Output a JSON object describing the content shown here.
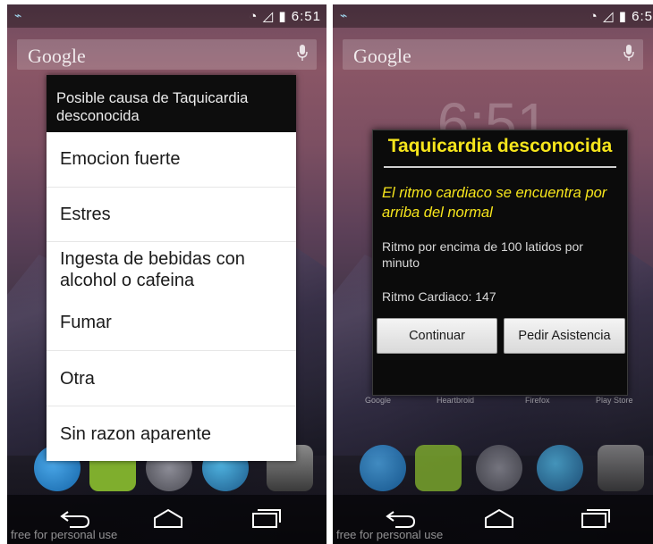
{
  "left_screen": {
    "status_time": "6:51",
    "search_label": "Google",
    "dialog": {
      "title": "Posible causa de Taquicardia desconocida",
      "options": [
        "Emocion fuerte",
        "Estres",
        "Ingesta de bebidas con alcohol o cafeina",
        "Fumar",
        "Otra",
        "Sin razon aparente"
      ]
    },
    "watermark": "free for personal use"
  },
  "right_screen": {
    "status_time": "6:5",
    "search_label": "Google",
    "clock_ghost": "6:51",
    "dialog": {
      "title": "Taquicardia desconocida",
      "subtitle": "El ritmo cardiaco se encuentra por arriba del normal",
      "description": "Ritmo por encima de 100 latidos por minuto",
      "rate": "Ritmo Cardiaco: 147",
      "continue_label": "Continuar",
      "assist_label": "Pedir Asistencia"
    },
    "app_labels": [
      "Google",
      "Heartbroid",
      "Firefox",
      "Play Store"
    ],
    "watermark": "free for personal use"
  },
  "colors": {
    "dialog_title_yellow": "#f6e51c",
    "dialog_bg_dark": "#0b0b0b",
    "status_icon_blue": "#9fd6ee"
  },
  "icons": [
    "pulse-icon",
    "wifi-icon",
    "signal-icon",
    "battery-icon",
    "mic-icon",
    "phone-icon",
    "messaging-icon",
    "apps-icon",
    "browser-icon",
    "camera-icon",
    "back-icon",
    "home-icon",
    "recents-icon"
  ]
}
